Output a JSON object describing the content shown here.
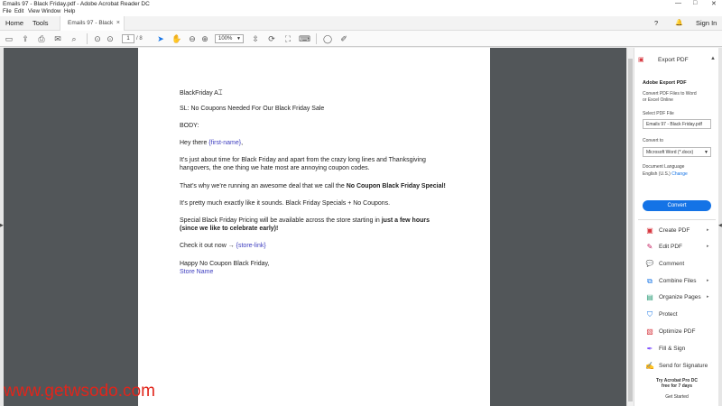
{
  "window": {
    "title": "Emails 97 - Black Friday.pdf - Adobe Acrobat Reader DC",
    "controls": [
      "—",
      "□",
      "✕"
    ]
  },
  "menu": [
    "File",
    "Edit",
    "View",
    "Window",
    "Help"
  ],
  "tabs": {
    "home": "Home",
    "tools": "Tools",
    "document": "Emails 97 - Black Fri...",
    "close": "×",
    "help": "?",
    "bell": "🔔",
    "signin": "Sign In"
  },
  "toolbar": {
    "page_current": "1",
    "page_total": "/ 8",
    "zoom": "100%"
  },
  "document": {
    "l1": "BlackFriday A",
    "l2": "SL: No Coupons Needed For Our Black Friday Sale",
    "l3": "BODY:",
    "l4a": "Hey there ",
    "l4b": "{first-name}",
    "l4c": ",",
    "l5": "It’s just about time for Black Friday and apart from the crazy long lines and Thanksgiving",
    "l6": "hangovers, the one thing we hate most are annoying coupon codes.",
    "l7a": "That’s why we’re running an awesome deal that we call the ",
    "l7b": "No Coupon Black Friday Special!",
    "l8": "It’s pretty much exactly like it sounds. Black Friday Specials + No Coupons.",
    "l9a": "Special Black Friday Pricing will be available across the store starting in ",
    "l9b": "just a few hours",
    "l10": "(since we like to celebrate early)!",
    "l11a": "Check it out now → ",
    "l11b": "{store-link}",
    "l12": "Happy No Coupon Black Friday,",
    "l13": "Store Name"
  },
  "panel": {
    "header": "Export PDF",
    "title": "Adobe Export PDF",
    "desc1": "Convert PDF Files to Word",
    "desc2": "or Excel Online",
    "select_label": "Select PDF File",
    "file": "Emails 97 - Black Friday.pdf",
    "convert_to": "Convert to",
    "format": "Microsoft Word (*.docx)",
    "doc_lang": "Document Language",
    "lang": "English (U.S.)",
    "change": "Change",
    "convert_btn": "Convert",
    "tools": [
      {
        "label": "Create PDF",
        "icon": "create-pdf-icon",
        "color": "#d7373f",
        "glyph": "▣"
      },
      {
        "label": "Edit PDF",
        "icon": "edit-pdf-icon",
        "color": "#c2185b",
        "glyph": "✎"
      },
      {
        "label": "Comment",
        "icon": "comment-icon",
        "color": "#e8a33d",
        "glyph": "💬"
      },
      {
        "label": "Combine Files",
        "icon": "combine-files-icon",
        "color": "#1473e6",
        "glyph": "⧉"
      },
      {
        "label": "Organize Pages",
        "icon": "organize-pages-icon",
        "color": "#2d9d78",
        "glyph": "▤"
      },
      {
        "label": "Protect",
        "icon": "protect-icon",
        "color": "#1473e6",
        "glyph": "⛉"
      },
      {
        "label": "Optimize PDF",
        "icon": "optimize-pdf-icon",
        "color": "#d7373f",
        "glyph": "▧"
      },
      {
        "label": "Fill & Sign",
        "icon": "fill-sign-icon",
        "color": "#7c4dff",
        "glyph": "✒"
      },
      {
        "label": "Send for Signature",
        "icon": "send-signature-icon",
        "color": "#7c4dff",
        "glyph": "✍"
      }
    ],
    "promo1": "Try Acrobat Pro DC",
    "promo2": "free for 7 days",
    "promo3": "Get Started"
  },
  "watermark": "www.getwsodo.com",
  "colors": {
    "accent": "#1473e6",
    "watermark": "#e1251b",
    "link": "#3d3dbf"
  }
}
